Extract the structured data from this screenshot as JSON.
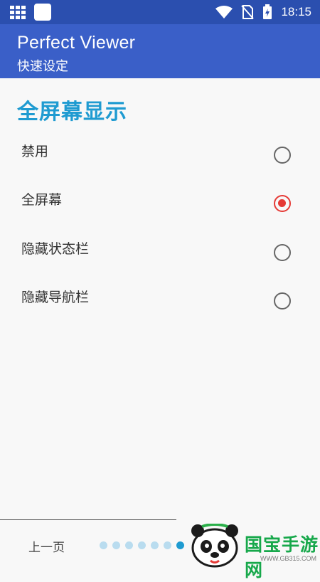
{
  "status_bar": {
    "time": "18:15",
    "icons": [
      "grid-icon",
      "app-square-icon",
      "wifi-icon",
      "no-sim-icon",
      "battery-charging-icon"
    ]
  },
  "app_bar": {
    "title": "Perfect Viewer",
    "subtitle": "快速设定"
  },
  "main": {
    "section_title": "全屏幕显示",
    "options": [
      {
        "label": "禁用",
        "selected": false
      },
      {
        "label": "全屏幕",
        "selected": true
      },
      {
        "label": "隐藏状态栏",
        "selected": false
      },
      {
        "label": "隐藏导航栏",
        "selected": false
      }
    ]
  },
  "bottom_bar": {
    "prev_label": "上一页",
    "page_dots": 7,
    "active_dot": 7
  },
  "watermark": {
    "text": "国宝手游网",
    "url": "WWW.GB315.COM"
  },
  "colors": {
    "status_bar": "#2b4faf",
    "app_bar": "#3a5fc8",
    "accent": "#1f9bd1",
    "radio_selected": "#e53935",
    "radio_unselected": "#666666"
  }
}
